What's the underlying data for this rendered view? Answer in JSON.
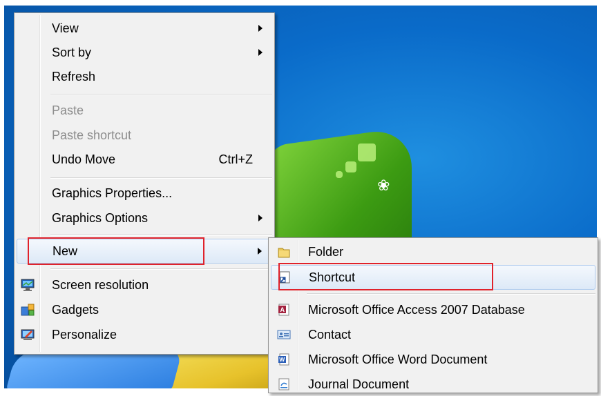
{
  "context_menu": {
    "groups": [
      [
        {
          "label": "View",
          "submenu": true
        },
        {
          "label": "Sort by",
          "submenu": true
        },
        {
          "label": "Refresh"
        }
      ],
      [
        {
          "label": "Paste",
          "disabled": true
        },
        {
          "label": "Paste shortcut",
          "disabled": true
        },
        {
          "label": "Undo Move",
          "shortcut": "Ctrl+Z"
        }
      ],
      [
        {
          "label": "Graphics Properties..."
        },
        {
          "label": "Graphics Options",
          "submenu": true
        }
      ],
      [
        {
          "label": "New",
          "submenu": true,
          "highlighted": true
        }
      ],
      [
        {
          "label": "Screen resolution",
          "icon": "screen-resolution-icon"
        },
        {
          "label": "Gadgets",
          "icon": "gadgets-icon"
        },
        {
          "label": "Personalize",
          "icon": "personalize-icon"
        }
      ]
    ]
  },
  "new_submenu": {
    "items": [
      {
        "label": "Folder",
        "icon": "folder-icon"
      },
      {
        "label": "Shortcut",
        "icon": "shortcut-icon",
        "highlighted": true
      },
      {
        "label": "Microsoft Office Access 2007 Database",
        "icon": "access-database-icon"
      },
      {
        "label": "Contact",
        "icon": "contact-card-icon"
      },
      {
        "label": "Microsoft Office Word Document",
        "icon": "word-document-icon"
      },
      {
        "label": "Journal Document",
        "icon": "journal-document-icon"
      }
    ]
  },
  "annotation_color": "#e0222b"
}
